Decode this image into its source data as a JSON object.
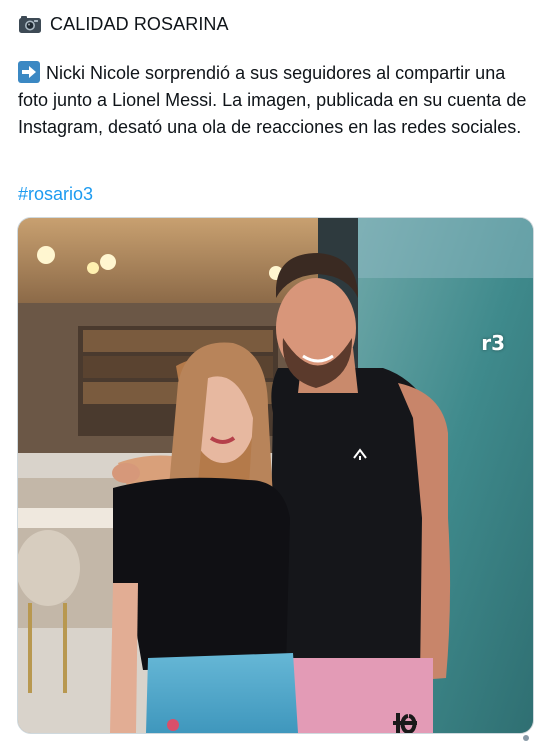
{
  "post": {
    "author": "CALIDAD ROSARINA",
    "body": "Nicki Nicole sorprendió a sus seguidores al compartir una foto junto a Lionel Messi. La imagen, publicada en su cuenta de Instagram, desató una ola de reacciones en las redes sociales.",
    "hashtag": "#rosario3",
    "icons": {
      "header": "camera-icon",
      "body": "right-arrow-icon"
    },
    "photo": {
      "watermark": "r3"
    }
  },
  "colors": {
    "link": "#1d9bf0",
    "text": "#0f1419",
    "arrow_badge": "#3b88c3"
  }
}
